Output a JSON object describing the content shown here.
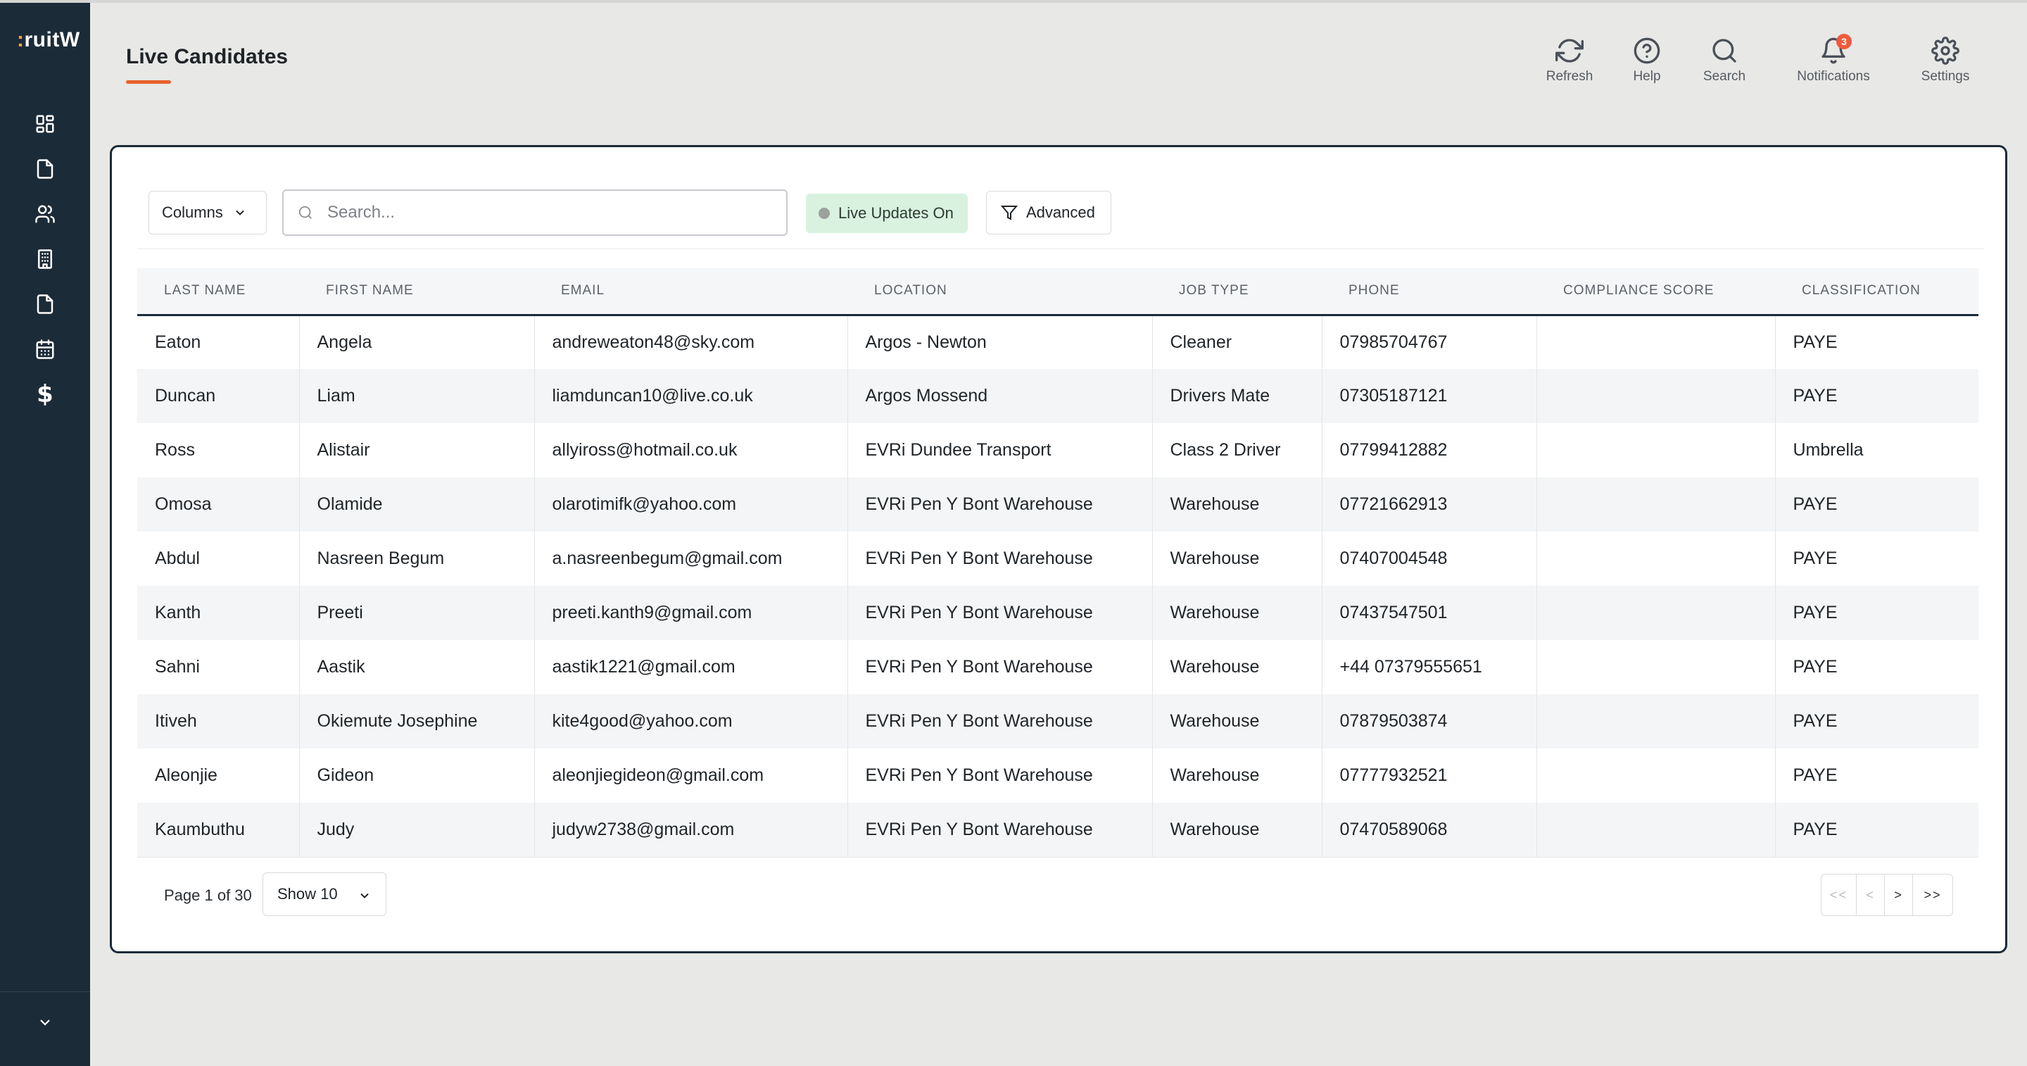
{
  "app": {
    "logo_text_main": "ruit",
    "logo_text_accent": ":",
    "logo_text_tail": "W"
  },
  "sidebar": {
    "items": [
      {
        "icon": "dashboard-grid-icon"
      },
      {
        "icon": "document-icon"
      },
      {
        "icon": "users-icon"
      },
      {
        "icon": "building-icon"
      },
      {
        "icon": "file-icon"
      },
      {
        "icon": "calendar-icon"
      },
      {
        "icon": "dollar-icon",
        "glyph": "$"
      }
    ],
    "collapse_icon": "chevron-down-icon"
  },
  "header": {
    "title": "Live Candidates",
    "actions": [
      {
        "label": "Refresh",
        "icon": "refresh-icon"
      },
      {
        "label": "Help",
        "icon": "help-icon"
      },
      {
        "label": "Search",
        "icon": "search-icon"
      },
      {
        "label": "Notifications",
        "icon": "bell-icon",
        "badge": "3"
      },
      {
        "label": "Settings",
        "icon": "gear-icon"
      }
    ]
  },
  "toolbar": {
    "columns_label": "Columns",
    "search_placeholder": "Search...",
    "search_value": "",
    "live_updates_label": "Live Updates On",
    "advanced_label": "Advanced"
  },
  "table": {
    "columns": [
      "LAST NAME",
      "FIRST NAME",
      "EMAIL",
      "LOCATION",
      "JOB TYPE",
      "PHONE",
      "COMPLIANCE SCORE",
      "CLASSIFICATION"
    ],
    "rows": [
      [
        "Eaton",
        "Angela",
        "andreweaton48@sky.com",
        "Argos - Newton",
        "Cleaner",
        "07985704767",
        "",
        "PAYE"
      ],
      [
        "Duncan",
        "Liam",
        "liamduncan10@live.co.uk",
        "Argos Mossend",
        "Drivers Mate",
        "07305187121",
        "",
        "PAYE"
      ],
      [
        "Ross",
        "Alistair",
        "allyiross@hotmail.co.uk",
        "EVRi Dundee Transport",
        "Class 2 Driver",
        "07799412882",
        "",
        "Umbrella"
      ],
      [
        "Omosa",
        "Olamide",
        "olarotimifk@yahoo.com",
        "EVRi Pen Y Bont Warehouse",
        "Warehouse",
        "07721662913",
        "",
        "PAYE"
      ],
      [
        "Abdul",
        "Nasreen Begum",
        "a.nasreenbegum@gmail.com",
        "EVRi Pen Y Bont Warehouse",
        "Warehouse",
        "07407004548",
        "",
        "PAYE"
      ],
      [
        "Kanth",
        "Preeti",
        "preeti.kanth9@gmail.com",
        "EVRi Pen Y Bont Warehouse",
        "Warehouse",
        "07437547501",
        "",
        "PAYE"
      ],
      [
        "Sahni",
        "Aastik",
        "aastik1221@gmail.com",
        "EVRi Pen Y Bont Warehouse",
        "Warehouse",
        "+44 07379555651",
        "",
        "PAYE"
      ],
      [
        "Itiveh",
        "Okiemute Josephine",
        "kite4good@yahoo.com",
        "EVRi Pen Y Bont Warehouse",
        "Warehouse",
        "07879503874",
        "",
        "PAYE"
      ],
      [
        "Aleonjie",
        "Gideon",
        "aleonjiegideon@gmail.com",
        "EVRi Pen Y Bont Warehouse",
        "Warehouse",
        "07777932521",
        "",
        "PAYE"
      ],
      [
        "Kaumbuthu",
        "Judy",
        "judyw2738@gmail.com",
        "EVRi Pen Y Bont Warehouse",
        "Warehouse",
        "07470589068",
        "",
        "PAYE"
      ]
    ]
  },
  "footer": {
    "page_info": "Page 1 of 30",
    "show_label": "Show 10",
    "pager": {
      "first": "<<",
      "prev": "<",
      "next": ">",
      "last": ">>"
    }
  },
  "colors": {
    "sidebar_bg": "#1c2b38",
    "accent": "#e8612c",
    "live_badge_bg": "#d8f2df",
    "notification_badge": "#ef5a3c"
  }
}
